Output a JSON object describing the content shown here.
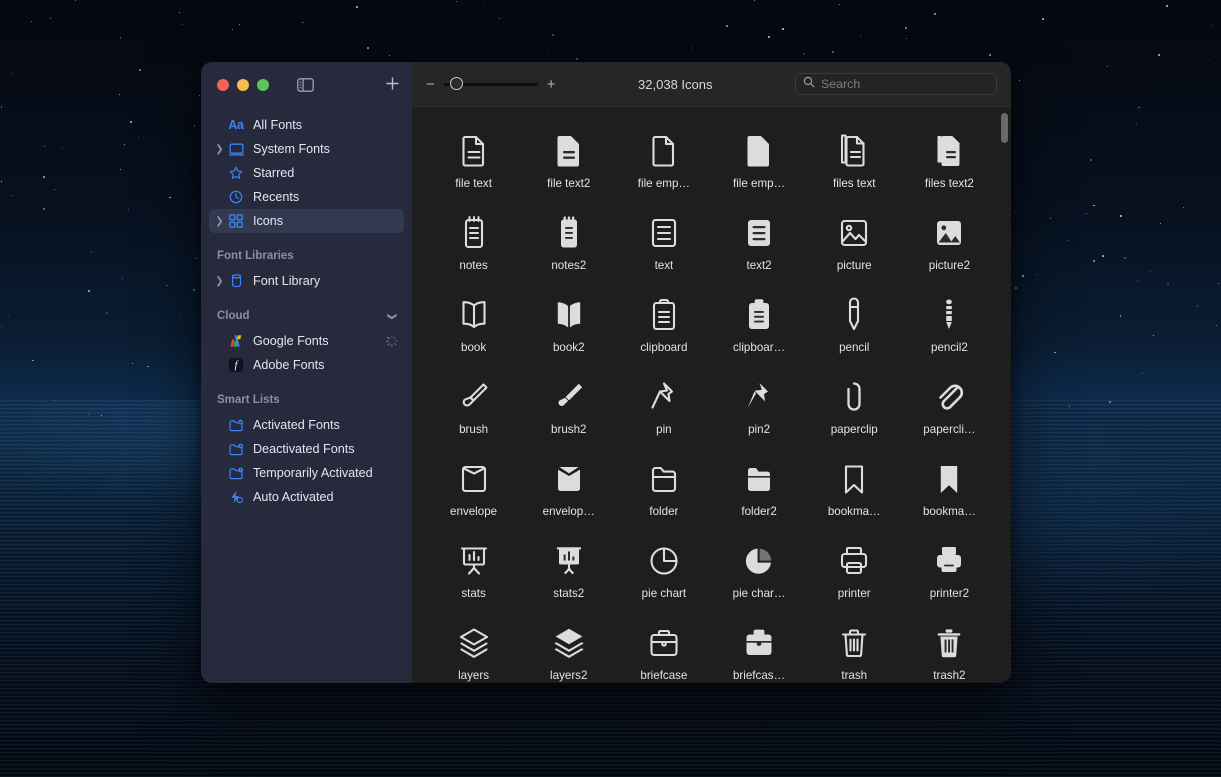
{
  "window": {
    "traffic_lights": [
      {
        "name": "close",
        "color": "#f2645a"
      },
      {
        "name": "minimize",
        "color": "#f4bd4f"
      },
      {
        "name": "zoom",
        "color": "#5ec45a"
      }
    ],
    "sidebar_toggle_label": "sidebar-toggle",
    "add_label": "+"
  },
  "sidebar": {
    "items": [
      {
        "label": "All Fonts",
        "icon": "aa-icon",
        "disclosure": false,
        "selected": false
      },
      {
        "label": "System Fonts",
        "icon": "computer-icon",
        "disclosure": true,
        "selected": false
      },
      {
        "label": "Starred",
        "icon": "star-icon",
        "disclosure": false,
        "selected": false
      },
      {
        "label": "Recents",
        "icon": "clock-icon",
        "disclosure": false,
        "selected": false
      },
      {
        "label": "Icons",
        "icon": "grid-icon",
        "disclosure": true,
        "selected": true
      }
    ],
    "sections": [
      {
        "title": "Font Libraries",
        "collapsible": false,
        "items": [
          {
            "label": "Font Library",
            "icon": "library-icon",
            "disclosure": true,
            "status": ""
          }
        ]
      },
      {
        "title": "Cloud",
        "collapsible": true,
        "items": [
          {
            "label": "Google Fonts",
            "icon": "google-icon",
            "disclosure": false,
            "status": "syncing"
          },
          {
            "label": "Adobe Fonts",
            "icon": "adobe-icon",
            "disclosure": false,
            "status": ""
          }
        ]
      },
      {
        "title": "Smart Lists",
        "collapsible": false,
        "items": [
          {
            "label": "Activated Fonts",
            "icon": "folder-check-icon",
            "disclosure": false,
            "status": ""
          },
          {
            "label": "Deactivated Fonts",
            "icon": "folder-off-icon",
            "disclosure": false,
            "status": ""
          },
          {
            "label": "Temporarily Activated",
            "icon": "folder-clock-icon",
            "disclosure": false,
            "status": ""
          },
          {
            "label": "Auto Activated",
            "icon": "bolt-icon",
            "disclosure": false,
            "status": ""
          }
        ]
      }
    ],
    "accent_color": "#3c82f6",
    "background_color": "#262a3c",
    "selected_row_color": "#333950"
  },
  "toolbar": {
    "zoom_out_label": "−",
    "zoom_in_label": "+",
    "zoom_value_percent": 8,
    "count_text": "32,038 Icons"
  },
  "search": {
    "placeholder": "Search",
    "value": ""
  },
  "grid": {
    "columns": 6,
    "items": [
      {
        "label": "file text",
        "icon": "file-text-outline-icon"
      },
      {
        "label": "file text2",
        "icon": "file-text-filled-icon"
      },
      {
        "label": "file emp…",
        "icon": "file-empty-outline-icon"
      },
      {
        "label": "file emp…",
        "icon": "file-empty-filled-icon"
      },
      {
        "label": "files text",
        "icon": "files-text-outline-icon"
      },
      {
        "label": "files text2",
        "icon": "files-text-filled-icon"
      },
      {
        "label": "notes",
        "icon": "notes-outline-icon"
      },
      {
        "label": "notes2",
        "icon": "notes-filled-icon"
      },
      {
        "label": "text",
        "icon": "text-outline-icon"
      },
      {
        "label": "text2",
        "icon": "text-filled-icon"
      },
      {
        "label": "picture",
        "icon": "picture-outline-icon"
      },
      {
        "label": "picture2",
        "icon": "picture-filled-icon"
      },
      {
        "label": "book",
        "icon": "book-outline-icon"
      },
      {
        "label": "book2",
        "icon": "book-filled-icon"
      },
      {
        "label": "clipboard",
        "icon": "clipboard-outline-icon"
      },
      {
        "label": "clipboar…",
        "icon": "clipboard-filled-icon"
      },
      {
        "label": "pencil",
        "icon": "pencil-outline-icon"
      },
      {
        "label": "pencil2",
        "icon": "pencil-filled-icon"
      },
      {
        "label": "brush",
        "icon": "brush-outline-icon"
      },
      {
        "label": "brush2",
        "icon": "brush-filled-icon"
      },
      {
        "label": "pin",
        "icon": "pin-outline-icon"
      },
      {
        "label": "pin2",
        "icon": "pin-filled-icon"
      },
      {
        "label": "paperclip",
        "icon": "paperclip-outline-icon"
      },
      {
        "label": "papercli…",
        "icon": "paperclip-filled-icon"
      },
      {
        "label": "envelope",
        "icon": "envelope-outline-icon"
      },
      {
        "label": "envelop…",
        "icon": "envelope-filled-icon"
      },
      {
        "label": "folder",
        "icon": "folder-outline-icon"
      },
      {
        "label": "folder2",
        "icon": "folder-filled-icon"
      },
      {
        "label": "bookma…",
        "icon": "bookmark-outline-icon"
      },
      {
        "label": "bookma…",
        "icon": "bookmark-filled-icon"
      },
      {
        "label": "stats",
        "icon": "stats-outline-icon"
      },
      {
        "label": "stats2",
        "icon": "stats-filled-icon"
      },
      {
        "label": "pie chart",
        "icon": "pie-chart-outline-icon"
      },
      {
        "label": "pie char…",
        "icon": "pie-chart-filled-icon"
      },
      {
        "label": "printer",
        "icon": "printer-outline-icon"
      },
      {
        "label": "printer2",
        "icon": "printer-filled-icon"
      },
      {
        "label": "layers",
        "icon": "layers-outline-icon"
      },
      {
        "label": "layers2",
        "icon": "layers-filled-icon"
      },
      {
        "label": "briefcase",
        "icon": "briefcase-outline-icon"
      },
      {
        "label": "briefcas…",
        "icon": "briefcase-filled-icon"
      },
      {
        "label": "trash",
        "icon": "trash-outline-icon"
      },
      {
        "label": "trash2",
        "icon": "trash-filled-icon"
      }
    ]
  }
}
